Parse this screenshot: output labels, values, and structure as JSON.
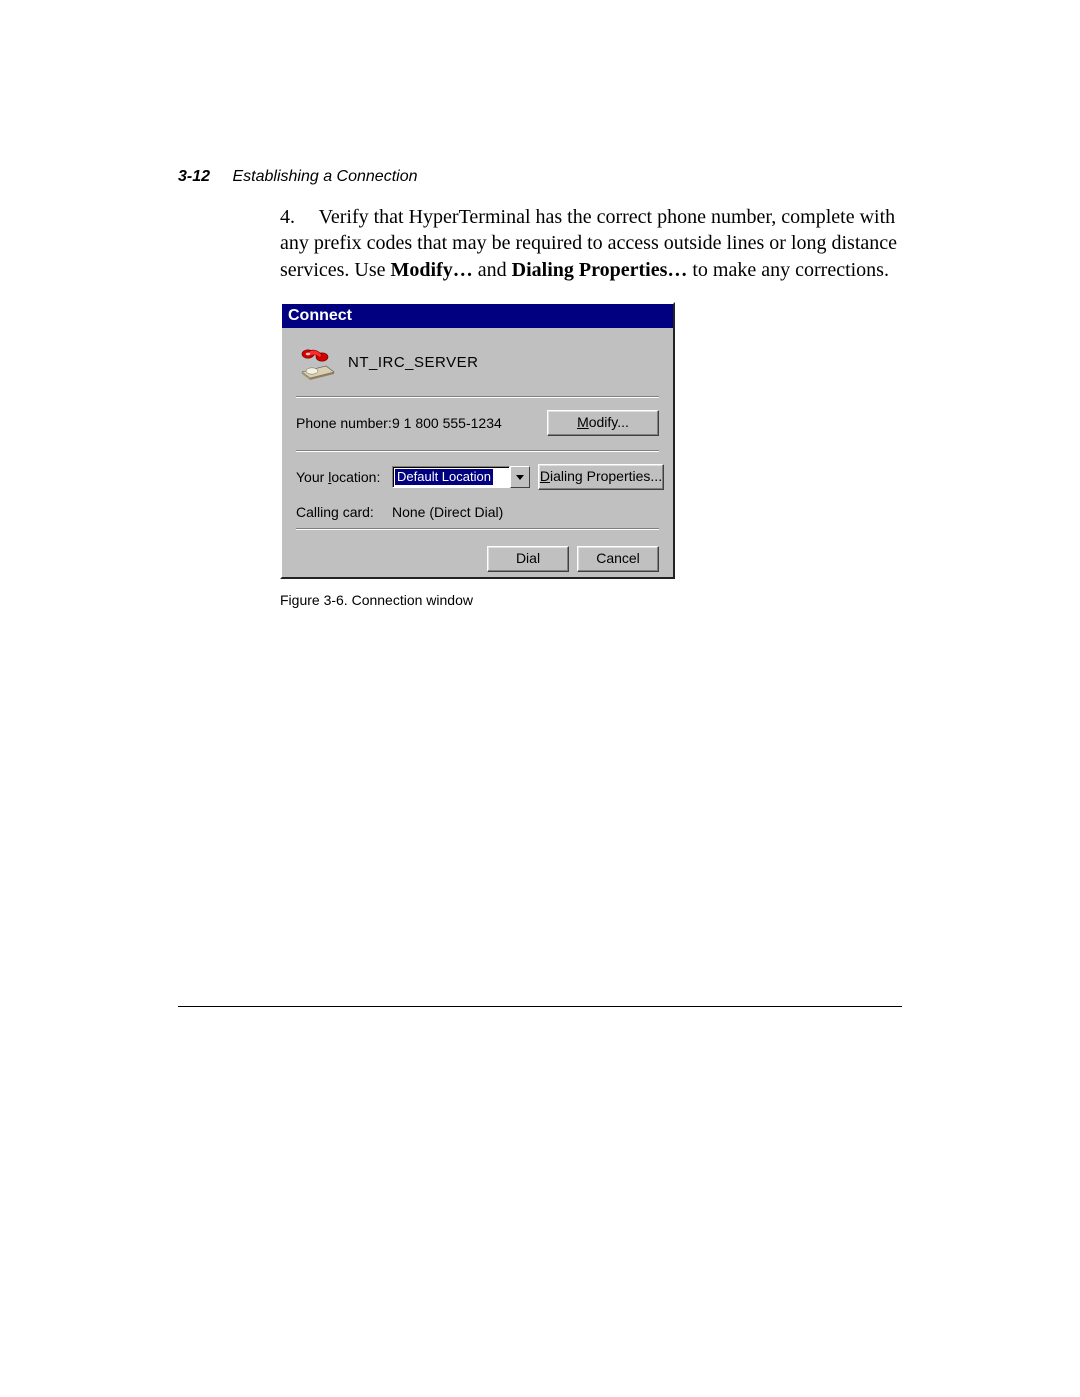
{
  "header": {
    "page_number": "3-12",
    "section_title": "Establishing a Connection"
  },
  "step": {
    "number": "4.",
    "text_before_bold1": "Verify that HyperTerminal has the correct phone number, complete with any prefix codes that may be required to access outside lines or long distance services. Use ",
    "bold1": "Modify…",
    "between": " and ",
    "bold2": "Dialing Properties…",
    "after": " to make any corrections."
  },
  "dialog": {
    "title": "Connect",
    "connection_name": "NT_IRC_SERVER",
    "phone_label": "Phone number:",
    "phone_value": "9  1 800 555-1234",
    "modify_pre": "M",
    "modify_rest": "odify...",
    "location_pre": "Your ",
    "location_u": "l",
    "location_rest": "ocation:",
    "location_value": "Default Location",
    "dialprops_pre": "D",
    "dialprops_rest": "ialing Properties...",
    "card_label": "Calling card:",
    "card_value": "None (Direct Dial)",
    "dial_label": "Dial",
    "cancel_label": "Cancel"
  },
  "figure_caption": "Figure 3-6.    Connection window"
}
